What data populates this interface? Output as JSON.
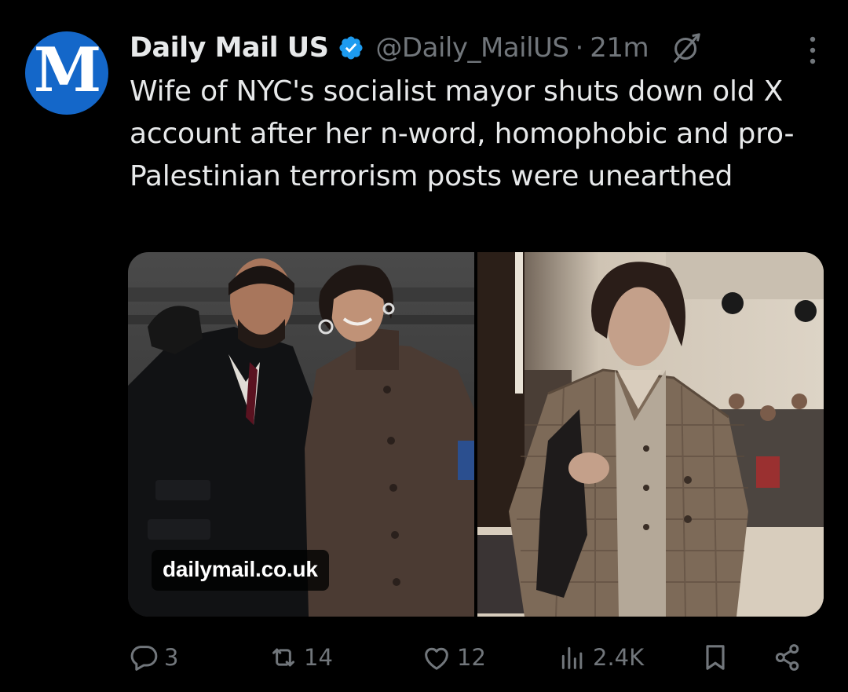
{
  "post": {
    "author": {
      "display_name": "Daily Mail US",
      "handle": "@Daily_MailUS",
      "separator": "·",
      "time": "21m",
      "avatar_letter": "M",
      "avatar_color": "#1467c9",
      "verified_color": "#1d9bf0"
    },
    "text": "Wife of NYC's socialist mayor shuts down old X account after her n-word, homophobic and pro-Palestinian terrorism posts were unearthed",
    "media": {
      "link_label": "dailymail.co.uk"
    },
    "actions": {
      "replies": "3",
      "reposts": "14",
      "likes": "12",
      "views": "2.4K"
    }
  },
  "icons": [
    "verified-badge-icon",
    "grok-icon",
    "more-icon",
    "reply-icon",
    "repost-icon",
    "like-icon",
    "views-icon",
    "bookmark-icon",
    "share-icon"
  ],
  "colors": {
    "background": "#000000",
    "text": "#e7e9ea",
    "muted": "#71767b"
  }
}
